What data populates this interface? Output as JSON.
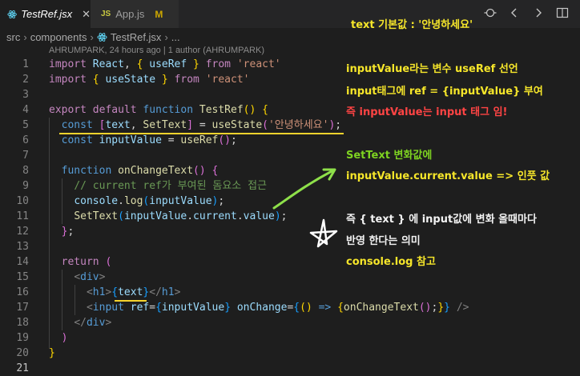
{
  "tabs": [
    {
      "label": "TestRef.jsx",
      "close": "✕"
    },
    {
      "badge": "JS",
      "label": "App.js",
      "status": "M"
    }
  ],
  "breadcrumb": [
    "src",
    "components",
    "TestRef.jsx",
    "..."
  ],
  "blame": "AHRUMPARK, 24 hours ago | 1 author (AHRUMPARK)",
  "code": {
    "l1": {
      "n": "1",
      "a": "import",
      "b": "React",
      "c": "useRef",
      "d": "from",
      "e": "'react'"
    },
    "l2": {
      "n": "2",
      "a": "import",
      "c": "useState",
      "d": "from",
      "e": "'react'"
    },
    "l3": {
      "n": "3"
    },
    "l4": {
      "n": "4",
      "a": "export",
      "b": "default",
      "c": "function",
      "d": "TestRef"
    },
    "l5": {
      "n": "5",
      "a": "const",
      "b": "text",
      "c": "SetText",
      "d": "useState",
      "e": "'안녕하세요'"
    },
    "l6": {
      "n": "6",
      "a": "const",
      "b": "inputValue",
      "c": "useRef"
    },
    "l7": {
      "n": "7"
    },
    "l8": {
      "n": "8",
      "a": "function",
      "b": "onChangeText"
    },
    "l9": {
      "n": "9",
      "comment": "// current ref가 부여된 돔요소 접근"
    },
    "l10": {
      "n": "10",
      "a": "console",
      "b": "log",
      "c": "inputValue"
    },
    "l11": {
      "n": "11",
      "a": "SetText",
      "b": "inputValue",
      "c": "current",
      "d": "value"
    },
    "l12": {
      "n": "12"
    },
    "l13": {
      "n": "13"
    },
    "l14": {
      "n": "14",
      "a": "return"
    },
    "l15": {
      "n": "15",
      "a": "div"
    },
    "l16": {
      "n": "16",
      "a": "h1",
      "b": "text",
      "c": "h1"
    },
    "l17": {
      "n": "17",
      "a": "input",
      "b": "ref",
      "c": "inputValue",
      "d": "onChange",
      "e": "onChangeText"
    },
    "l18": {
      "n": "18",
      "a": "div"
    },
    "l19": {
      "n": "19"
    },
    "l20": {
      "n": "20"
    },
    "l21": {
      "n": "21"
    }
  },
  "annotations": {
    "title": "text 기본값 : '안녕하세요'",
    "ref1": "inputValue라는 변수 useRef 선언",
    "ref2": "input태그에 ref = {inputValue} 부여",
    "ref3": "즉 inputValue는 input 태그 임!",
    "set1": "SetText 변화값에",
    "set2": "inputValue.current.value => 인풋 값",
    "mean1": "즉 { text } 에 input값에 변화 올때마다",
    "mean2": "반영 한다는 의미",
    "mean3": "console.log 참고"
  },
  "colors": {
    "annotation_yellow": "#f6e62a",
    "annotation_red": "#ff4444",
    "annotation_green": "#7ed321",
    "underline": "#f6d32d"
  }
}
